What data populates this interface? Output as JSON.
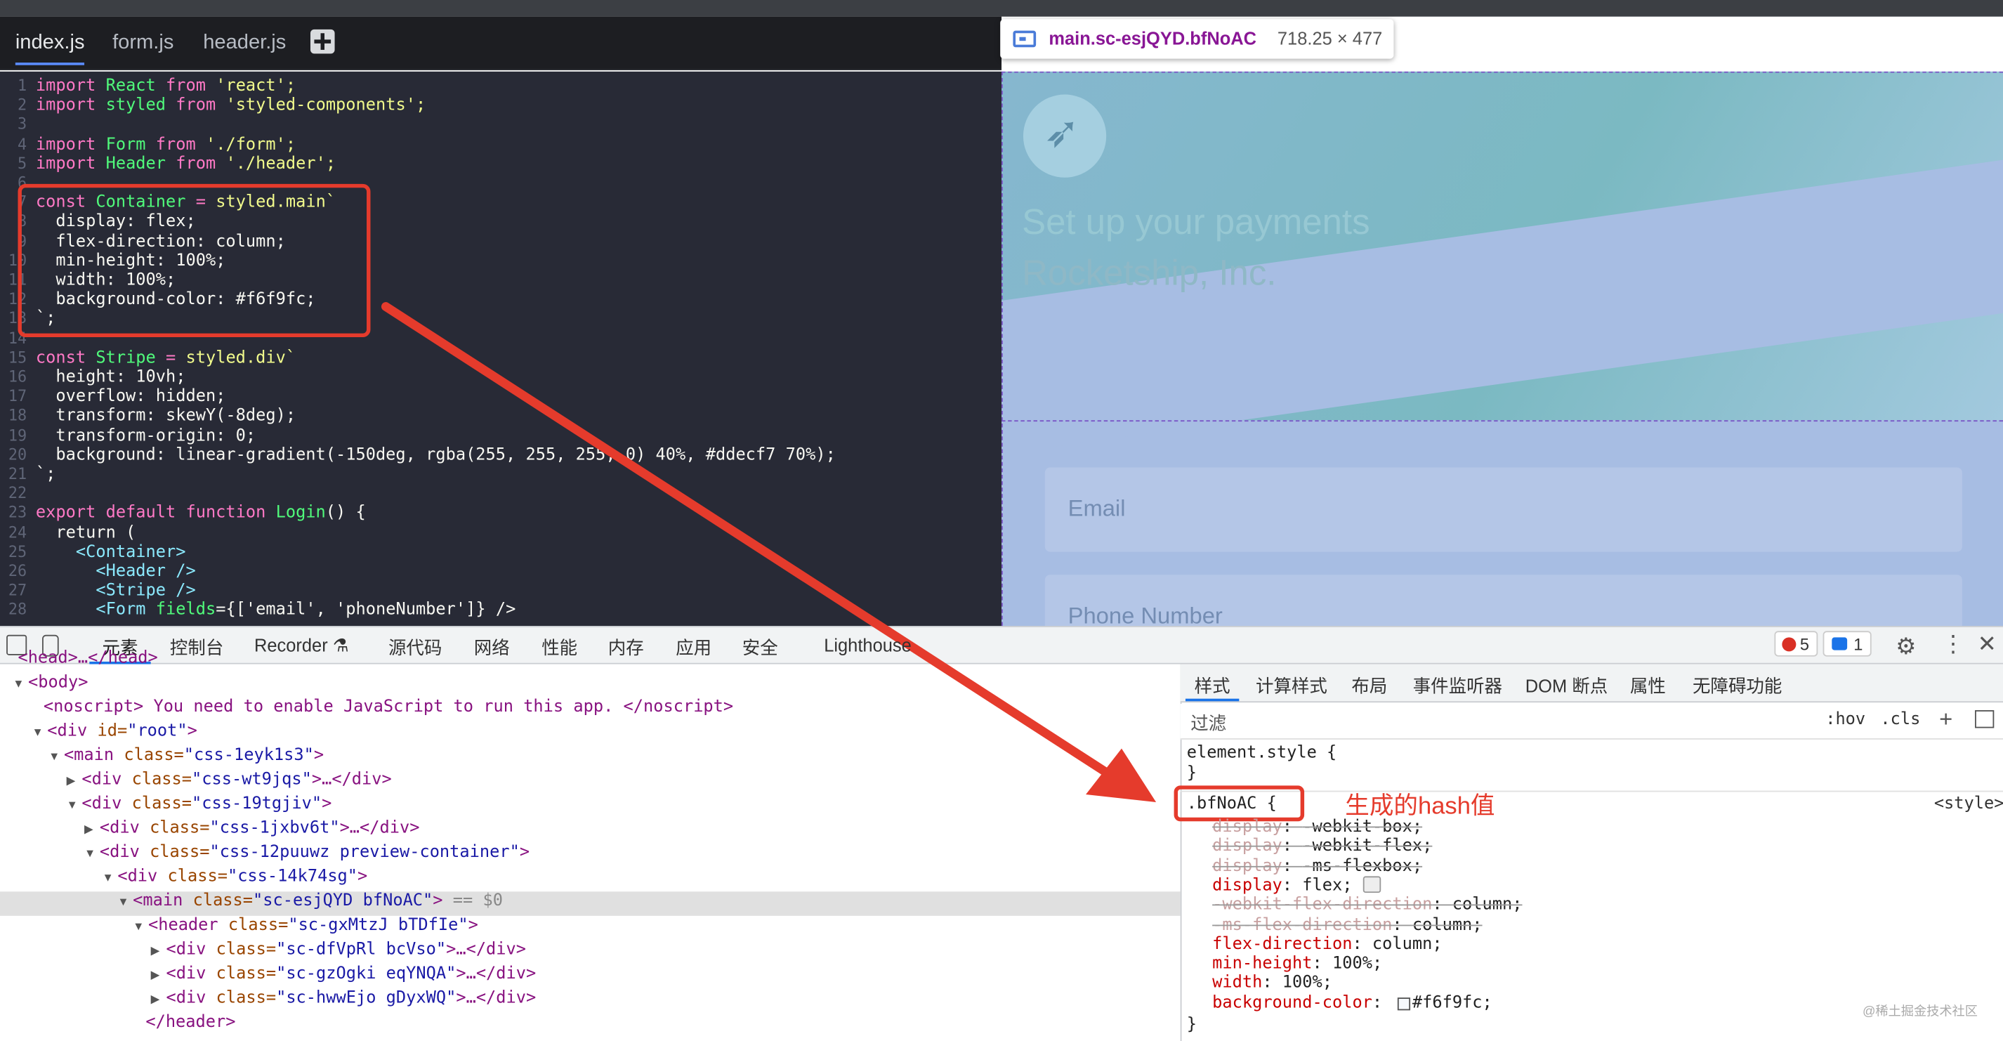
{
  "editor": {
    "tabs": [
      "index.js",
      "form.js",
      "header.js"
    ],
    "line_numbers": [
      "1",
      "2",
      "3",
      "4",
      "5",
      "6",
      "7",
      "8",
      "9",
      "10",
      "11",
      "12",
      "13",
      "14",
      "15",
      "16",
      "17",
      "18",
      "19",
      "20",
      "21",
      "22",
      "23",
      "24",
      "25",
      "26",
      "27",
      "28"
    ],
    "lines": [
      {
        "kw": "import ",
        "id": "React ",
        "kw2": "from ",
        "str": "'react';"
      },
      {
        "kw": "import ",
        "id": "styled ",
        "kw2": "from ",
        "str": "'styled-components';"
      },
      {},
      {
        "kw": "import ",
        "id": "Form ",
        "kw2": "from ",
        "str": "'./form';"
      },
      {
        "kw": "import ",
        "id": "Header ",
        "kw2": "from ",
        "str": "'./header';"
      },
      {},
      {
        "kw": "const ",
        "id": "Container ",
        "kw2": "= ",
        "str": "styled.main`"
      },
      {
        "plain": "  display: flex;"
      },
      {
        "plain": "  flex-direction: column;"
      },
      {
        "plain": "  min-height: 100%;"
      },
      {
        "plain": "  width: 100%;"
      },
      {
        "plain": "  background-color: #f6f9fc;"
      },
      {
        "plain": "`;"
      },
      {},
      {
        "kw": "const ",
        "id": "Stripe ",
        "kw2": "= ",
        "str": "styled.div`"
      },
      {
        "plain": "  height: 10vh;"
      },
      {
        "plain": "  overflow: hidden;"
      },
      {
        "plain": "  transform: skewY(-8deg);"
      },
      {
        "plain": "  transform-origin: 0;"
      },
      {
        "plain": "  background: linear-gradient(-150deg, rgba(255, 255, 255, 0) 40%, #ddecf7 70%);"
      },
      {
        "plain": "`;"
      },
      {},
      {
        "kw": "export default function ",
        "id": "Login",
        "plain2": "() {"
      },
      {
        "plain": "  return ("
      },
      {
        "plain": "    ",
        "tag": "<Container>"
      },
      {
        "plain": "      ",
        "tag": "<Header />"
      },
      {
        "plain": "      ",
        "tag": "<Stripe />"
      },
      {
        "plain": "      ",
        "tag": "<Form ",
        "id": "fields",
        "plain2": "={['email', 'phoneNumber']} />"
      }
    ]
  },
  "preview": {
    "tooltip_selector": "main.sc-esjQYD.bfNoAC",
    "tooltip_dims": "718.25 × 477",
    "heading": "Set up your payments",
    "company": "Rocketship, Inc.",
    "email_placeholder": "Email",
    "phone_placeholder": "Phone Number"
  },
  "devtools": {
    "tabs": [
      "元素",
      "控制台",
      "Recorder ⚗",
      "源代码",
      "网络",
      "性能",
      "内存",
      "应用",
      "安全",
      "Lighthouse"
    ],
    "error_count": "5",
    "message_count": "1",
    "dom_lines": [
      {
        "ind": "  ",
        "t": "<head>…</head>"
      },
      {
        "ind": "▼",
        "t": "<body>"
      },
      {
        "ind": "",
        "t": "<noscript> You need to enable JavaScript to run this app. </noscript>"
      },
      {
        "ind": "▼",
        "t": "<div id=\"root\">"
      },
      {
        "ind": "▼",
        "t": "<main class=\"css-1eyk1s3\">"
      },
      {
        "ind": "▶",
        "t": "<div class=\"css-wt9jqs\">…</div>"
      },
      {
        "ind": "▼",
        "t": "<div class=\"css-19tgjiv\">"
      },
      {
        "ind": "▶",
        "t": "<div class=\"css-1jxbv6t\">…</div>"
      },
      {
        "ind": "▼",
        "t": "<div class=\"css-12puuwz preview-container\">"
      },
      {
        "ind": "▼",
        "t": "<div class=\"css-14k74sg\">"
      },
      {
        "ind": "▼",
        "t": "<main class=\"sc-esjQYD bfNoAC\"> == $0"
      },
      {
        "ind": "▼",
        "t": "<header class=\"sc-gxMtzJ bTDfIe\">"
      },
      {
        "ind": "▶",
        "t": "<div class=\"sc-dfVpRl bcVso\">…</div>"
      },
      {
        "ind": "▶",
        "t": "<div class=\"sc-gzOgki eqYNQA\">…</div>"
      },
      {
        "ind": "▶",
        "t": "<div class=\"sc-hwwEjo gDyxWQ\">…</div>"
      },
      {
        "ind": "",
        "t": "</header>"
      }
    ],
    "style_tabs": [
      "样式",
      "计算样式",
      "布局",
      "事件监听器",
      "DOM 断点",
      "属性",
      "无障碍功能"
    ],
    "filter_placeholder": "过滤",
    "hov": ":hov",
    "cls": ".cls",
    "element_style": "element.style {",
    "close_brace": "}",
    "rule_selector": ".bfNoAC {",
    "rule_source": "<style>",
    "annotation": "生成的hash值",
    "props": [
      {
        "name": "display",
        "value": "-webkit-box;",
        "struck": true
      },
      {
        "name": "display",
        "value": "-webkit-flex;",
        "struck": true
      },
      {
        "name": "display",
        "value": "-ms-flexbox;",
        "struck": true
      },
      {
        "name": "display",
        "value": "flex;",
        "struck": false
      },
      {
        "name": "-webkit-flex-direction",
        "value": "column;",
        "struck": true
      },
      {
        "name": "-ms-flex-direction",
        "value": "column;",
        "struck": true
      },
      {
        "name": "flex-direction",
        "value": "column;",
        "struck": false
      },
      {
        "name": "min-height",
        "value": "100%;",
        "struck": false
      },
      {
        "name": "width",
        "value": "100%;",
        "struck": false
      },
      {
        "name": "background-color",
        "value": "#f6f9fc;",
        "struck": false
      }
    ],
    "watermark": "@稀土掘金技术社区"
  },
  "colors": {
    "highlight_red": "#e53b2c",
    "bg_value": "#f6f9fc"
  }
}
